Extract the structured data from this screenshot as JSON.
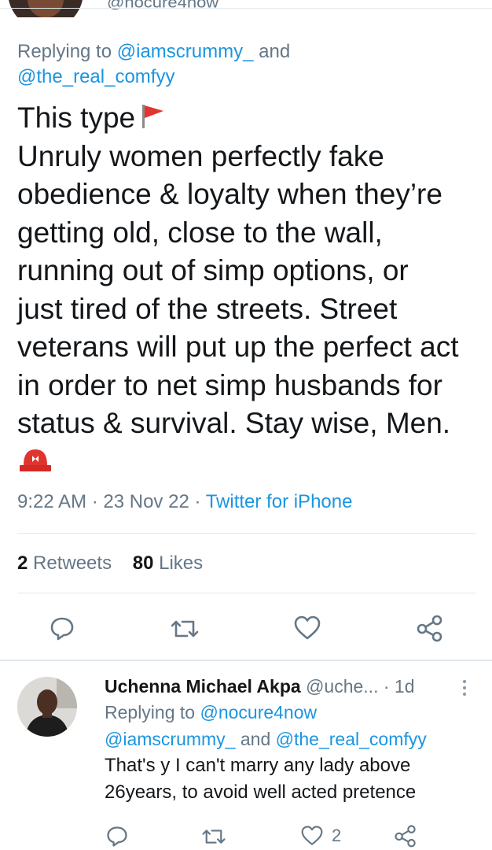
{
  "top": {
    "handle_fragment": "@nocure4now"
  },
  "tweet": {
    "replying_prefix": "Replying to ",
    "mention_1": "@iamscrummy_",
    "and_word": " and",
    "mention_2": "@the_real_comfyy",
    "text_line_1": "This type",
    "text_body": "Unruly women perfectly fake\nobedience & loyalty when they’re\ngetting old, close to the wall,\nrunning out of simp options, or\njust tired of the streets. Street\nveterans will put up the perfect act\nin order to net simp husbands for\nstatus & survival. Stay wise, Men.",
    "emoji_flag": "triangular-flag-icon",
    "emoji_siren": "police-light-icon",
    "time": "9:22 AM",
    "date": "23 Nov 22",
    "source": "Twitter for iPhone",
    "retweets_count": "2",
    "retweets_label": "Retweets",
    "likes_count": "80",
    "likes_label": "Likes"
  },
  "reply": {
    "name": "Uchenna Michael Akpa",
    "handle": "@uche...",
    "time": "1d",
    "replying_prefix": "Replying to ",
    "mention_1": "@nocure4now",
    "mention_2": "@iamscrummy_",
    "and_word": " and ",
    "mention_3": "@the_real_comfyy",
    "text": "That's y I can't marry any lady above 26years, to avoid well acted pretence",
    "likes": "2"
  },
  "colors": {
    "link": "#1b95e0",
    "muted": "#657786",
    "text": "#14171a",
    "divider": "#e1e8ed"
  }
}
